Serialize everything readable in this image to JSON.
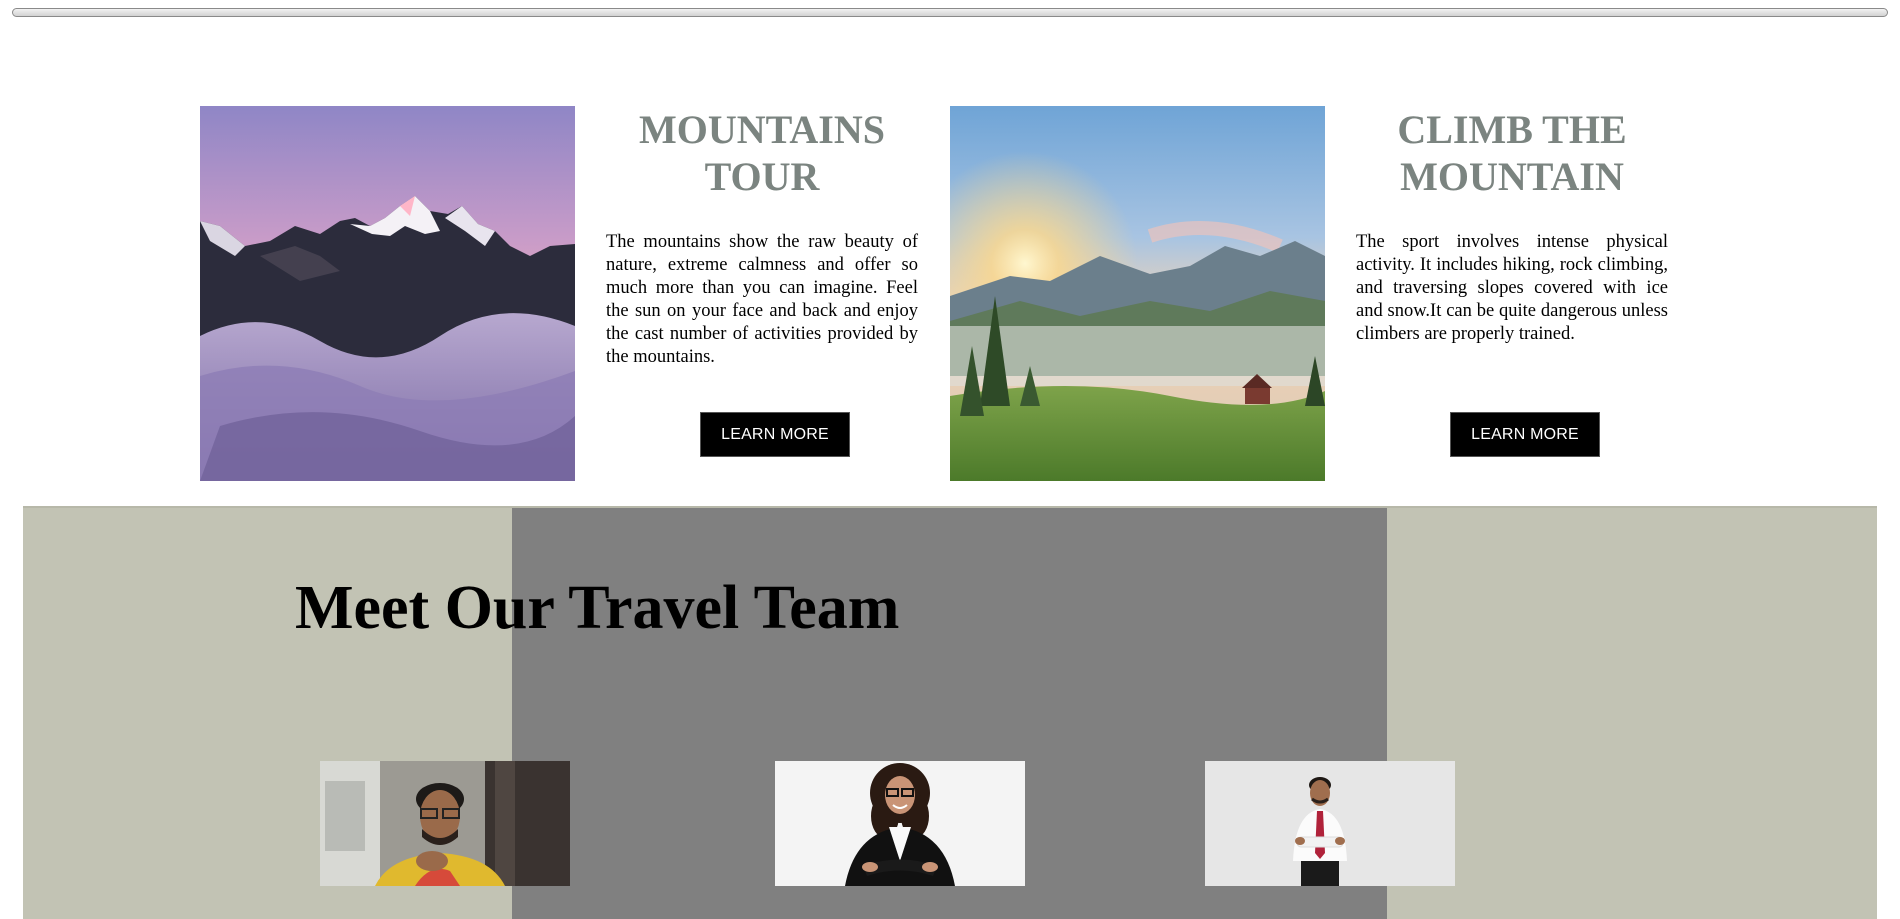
{
  "features": [
    {
      "title": "MOUNTAINS TOUR",
      "body": "The mountains show the raw beauty of nature, extreme calmness and offer so much more than you can imagine. Feel the sun on your face and back and enjoy the cast number of activities provided by the mountains.",
      "button_label": "LEARN MORE",
      "image": "snowy-peaks-above-clouds"
    },
    {
      "title": "CLIMB THE MOUNTAIN",
      "body": "The sport involves intense physical activity. It includes hiking, rock climbing, and traversing slopes covered with ice and snow.It can be quite dangerous unless climbers are properly trained.",
      "button_label": "LEARN MORE",
      "image": "sunrise-mountain-valley"
    }
  ],
  "team": {
    "title": "Meet Our Travel Team",
    "members": [
      {
        "image": "man-with-glasses-yellow-shirt"
      },
      {
        "image": "woman-curly-hair-black-blazer"
      },
      {
        "image": "man-white-shirt-red-tie"
      }
    ]
  },
  "colors": {
    "heading": "#7b8480",
    "team_bg": "#c2c3b4",
    "team_panel": "#808080",
    "button_bg": "#000000"
  }
}
